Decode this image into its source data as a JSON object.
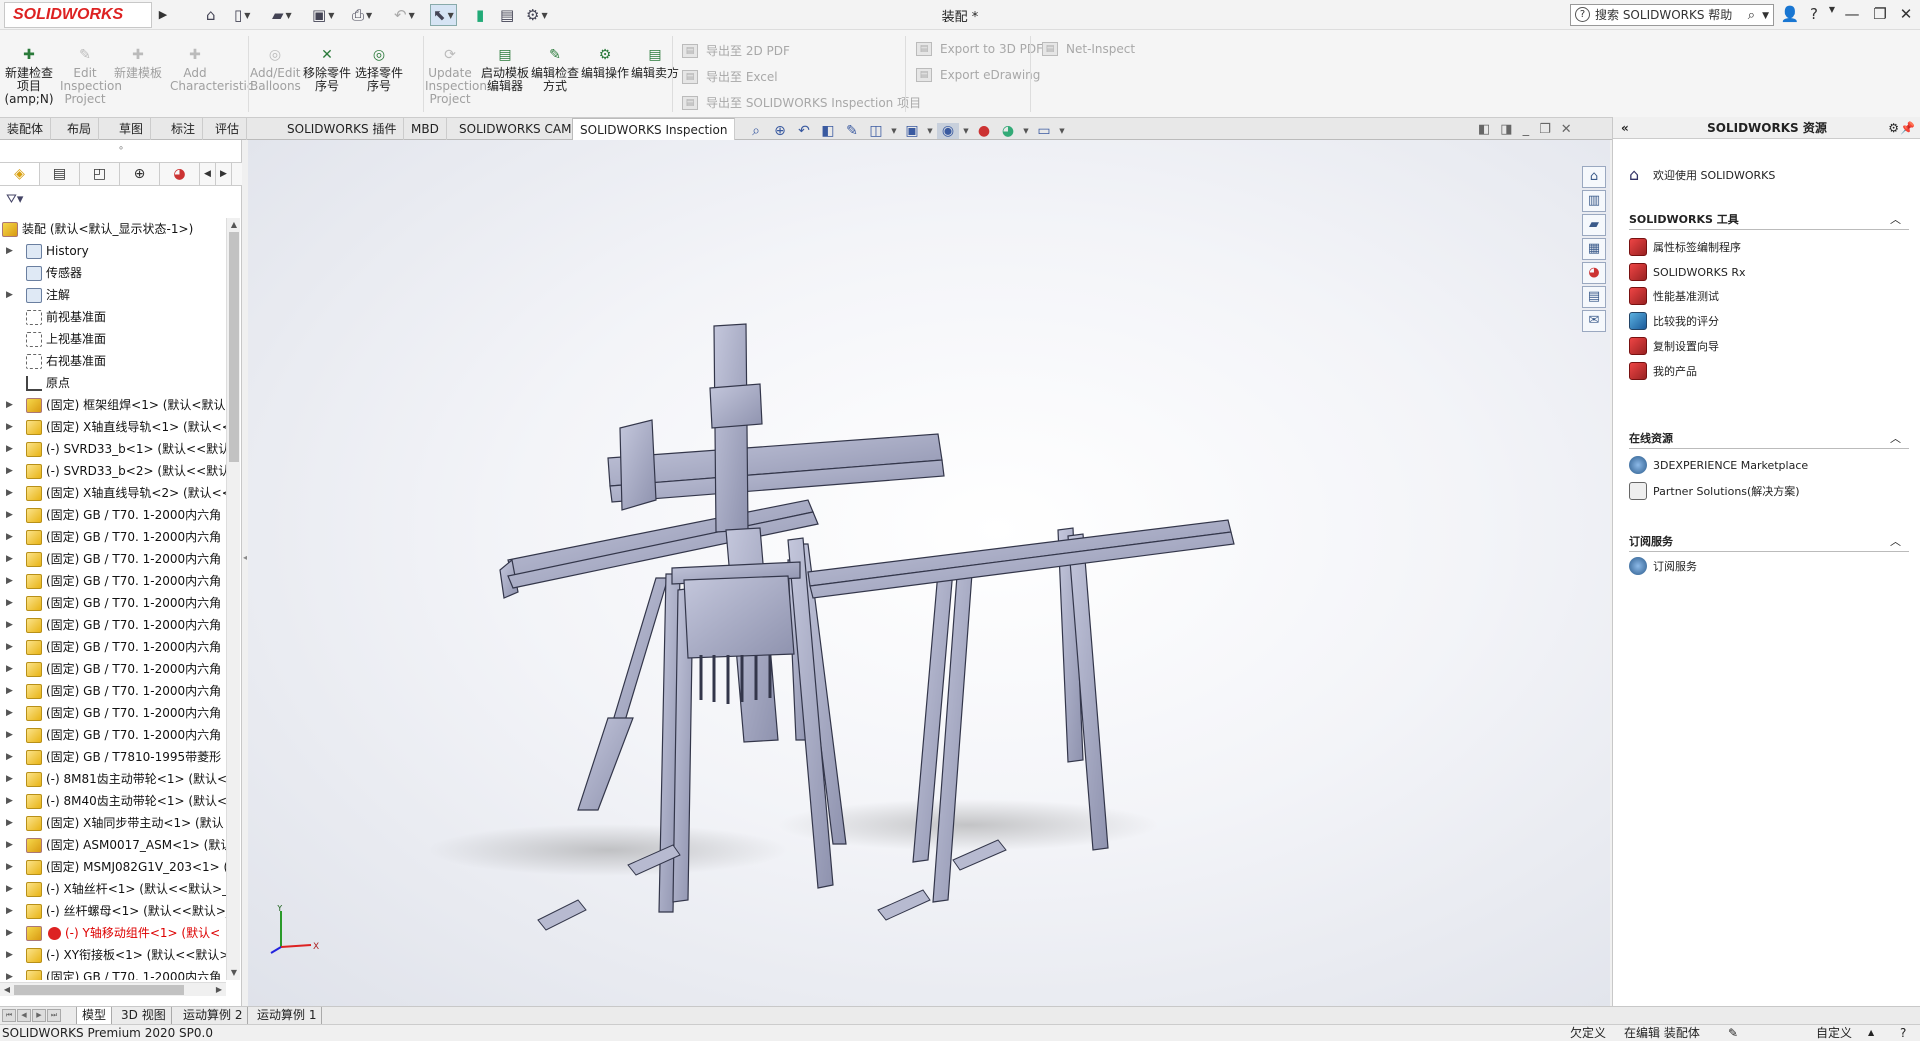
{
  "app": {
    "logo": "SOLIDWORKS",
    "title": "装配 *"
  },
  "search": {
    "placeholder": "搜索 SOLIDWORKS 帮助"
  },
  "ribbon": {
    "buttons": [
      {
        "label": "新建检查项目 (amp;N)",
        "enabled": true
      },
      {
        "label": "Edit Inspection Project",
        "enabled": false
      },
      {
        "label": "新建模板",
        "enabled": false
      },
      {
        "label": "Add Characteristic",
        "enabled": false
      },
      {
        "label": "Add/Edit Balloons",
        "enabled": false
      },
      {
        "label": "移除零件序号",
        "enabled": true
      },
      {
        "label": "选择零件序号",
        "enabled": true
      },
      {
        "label": "Update Inspection Project",
        "enabled": false
      },
      {
        "label": "启动模板编辑器",
        "enabled": true
      },
      {
        "label": "编辑检查方式",
        "enabled": true
      },
      {
        "label": "编辑操作",
        "enabled": true
      },
      {
        "label": "编辑卖方",
        "enabled": true
      }
    ],
    "export": [
      "导出至 2D PDF",
      "导出至 Excel",
      "导出至 SOLIDWORKS Inspection 项目"
    ],
    "export2": [
      "Export to 3D PDF",
      "Export eDrawing"
    ],
    "net_inspect": "Net-Inspect"
  },
  "command_tabs": [
    "装配体",
    "布局",
    "草图",
    "标注",
    "评估",
    "SOLIDWORKS 插件",
    "MBD",
    "SOLIDWORKS CAM",
    "SOLIDWORKS Inspection"
  ],
  "active_command_tab": "SOLIDWORKS Inspection",
  "feature_tree": {
    "root": "装配 (默认<默认_显示状态-1>)",
    "items": [
      {
        "label": "History",
        "icon": "folder-icon"
      },
      {
        "label": "传感器",
        "icon": "sensor-icon"
      },
      {
        "label": "注解",
        "icon": "annotation-icon"
      },
      {
        "label": "前视基准面",
        "icon": "plane-icon"
      },
      {
        "label": "上视基准面",
        "icon": "plane-icon"
      },
      {
        "label": "右视基准面",
        "icon": "plane-icon"
      },
      {
        "label": "原点",
        "icon": "origin-icon"
      },
      {
        "label": "(固定) 框架组焊<1> (默认<默认",
        "icon": "assembly-icon"
      },
      {
        "label": "(固定) X轴直线导轨<1> (默认<<",
        "icon": "part-icon"
      },
      {
        "label": "(-) SVRD33_b<1> (默认<<默认",
        "icon": "part-icon"
      },
      {
        "label": "(-) SVRD33_b<2> (默认<<默认",
        "icon": "part-icon"
      },
      {
        "label": "(固定) X轴直线导轨<2> (默认<<",
        "icon": "part-icon"
      },
      {
        "label": "(固定) GB / T70. 1-2000内六角",
        "icon": "part-icon"
      },
      {
        "label": "(固定) GB / T70. 1-2000内六角",
        "icon": "part-icon"
      },
      {
        "label": "(固定) GB / T70. 1-2000内六角",
        "icon": "part-icon"
      },
      {
        "label": "(固定) GB / T70. 1-2000内六角",
        "icon": "part-icon"
      },
      {
        "label": "(固定) GB / T70. 1-2000内六角",
        "icon": "part-icon"
      },
      {
        "label": "(固定) GB / T70. 1-2000内六角",
        "icon": "part-icon"
      },
      {
        "label": "(固定) GB / T70. 1-2000内六角",
        "icon": "part-icon"
      },
      {
        "label": "(固定) GB / T70. 1-2000内六角",
        "icon": "part-icon"
      },
      {
        "label": "(固定) GB / T70. 1-2000内六角",
        "icon": "part-icon"
      },
      {
        "label": "(固定) GB / T70. 1-2000内六角",
        "icon": "part-icon"
      },
      {
        "label": "(固定) GB / T70. 1-2000内六角",
        "icon": "part-icon"
      },
      {
        "label": "(固定) GB / T7810-1995带菱形",
        "icon": "part-icon"
      },
      {
        "label": "(-) 8M81齿主动带轮<1> (默认<",
        "icon": "part-icon"
      },
      {
        "label": "(-) 8M40齿主动带轮<1> (默认<",
        "icon": "part-icon"
      },
      {
        "label": "(固定) X轴同步带主动<1> (默认",
        "icon": "part-icon"
      },
      {
        "label": "(固定) ASM0017_ASM<1> (默认",
        "icon": "assembly-icon"
      },
      {
        "label": "(固定) MSMJ082G1V_203<1> (",
        "icon": "part-icon"
      },
      {
        "label": "(-) X轴丝杆<1> (默认<<默认>_",
        "icon": "part-icon"
      },
      {
        "label": "(-) 丝杆螺母<1> (默认<<默认>_",
        "icon": "part-icon"
      },
      {
        "label": "(-) Y轴移动组件<1> (默认<",
        "icon": "error-icon"
      },
      {
        "label": "(-) XY衔接板<1> (默认<<默认>",
        "icon": "part-icon"
      },
      {
        "label": "(固定) GB / T70. 1-2000内六角",
        "icon": "part-icon"
      }
    ]
  },
  "task_pane": {
    "title": "SOLIDWORKS 资源",
    "welcome": "欢迎使用 SOLIDWORKS",
    "tools_title": "SOLIDWORKS 工具",
    "tools": [
      "属性标签编制程序",
      "SOLIDWORKS Rx",
      "性能基准测试",
      "比较我的评分",
      "复制设置向导",
      "我的产品"
    ],
    "online_title": "在线资源",
    "online": [
      "3DEXPERIENCE Marketplace",
      "Partner Solutions(解决方案)"
    ],
    "sub_title": "订阅服务",
    "sub": [
      "订阅服务"
    ]
  },
  "bottom_tabs": [
    "模型",
    "3D 视图",
    "运动算例 2",
    "运动算例 1"
  ],
  "status": {
    "left": "SOLIDWORKS Premium 2020 SP0.0",
    "underdefined": "欠定义",
    "editing": "在编辑 装配体",
    "custom": "自定义"
  },
  "triad": {
    "x": "X",
    "y": "Y"
  },
  "colors": {
    "accent": "#d22020",
    "model": "#a9acc6",
    "error": "#d00000"
  }
}
